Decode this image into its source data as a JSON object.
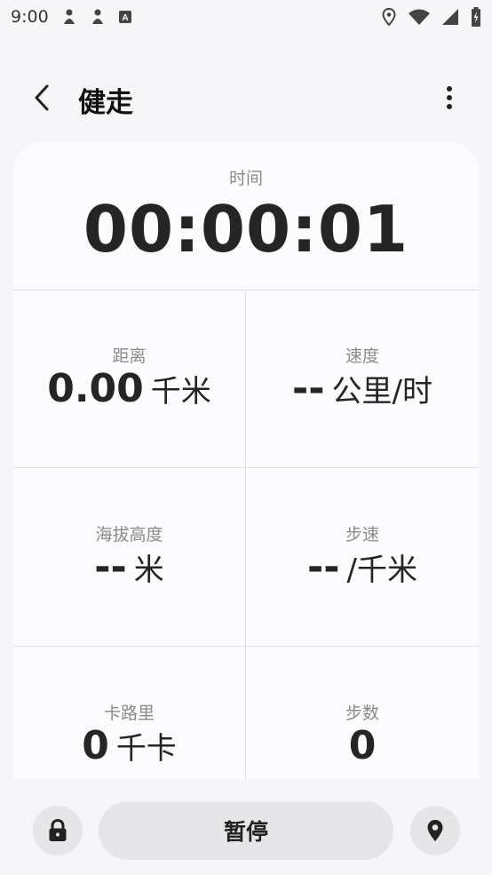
{
  "status_bar": {
    "time": "9:00",
    "icons_left": [
      "notification-icon",
      "notification-icon",
      "keyboard-a-icon"
    ],
    "icons_right": [
      "location-icon",
      "wifi-icon",
      "signal-icon",
      "battery-charging-icon"
    ]
  },
  "header": {
    "title": "健走",
    "back_icon": "chevron-left-icon",
    "more_icon": "more-vertical-icon"
  },
  "time_panel": {
    "label": "时间",
    "value": "00:00:01"
  },
  "metrics": [
    {
      "label": "距离",
      "value": "0.00",
      "unit": "千米"
    },
    {
      "label": "速度",
      "value": "--",
      "unit": "公里/时"
    },
    {
      "label": "海拔高度",
      "value": "--",
      "unit": "米"
    },
    {
      "label": "步速",
      "value": "--",
      "unit": "/千米"
    },
    {
      "label": "卡路里",
      "value": "0",
      "unit": "千卡"
    },
    {
      "label": "步数",
      "value": "0",
      "unit": ""
    }
  ],
  "controls": {
    "pause_label": "暂停",
    "lock_icon": "lock-icon",
    "map_icon": "location-pin-icon"
  },
  "colors": {
    "background": "#f6f6f8",
    "card": "#fcfcfe",
    "button": "#e6e6e8",
    "text": "#252525",
    "label": "#8a8a8a"
  }
}
